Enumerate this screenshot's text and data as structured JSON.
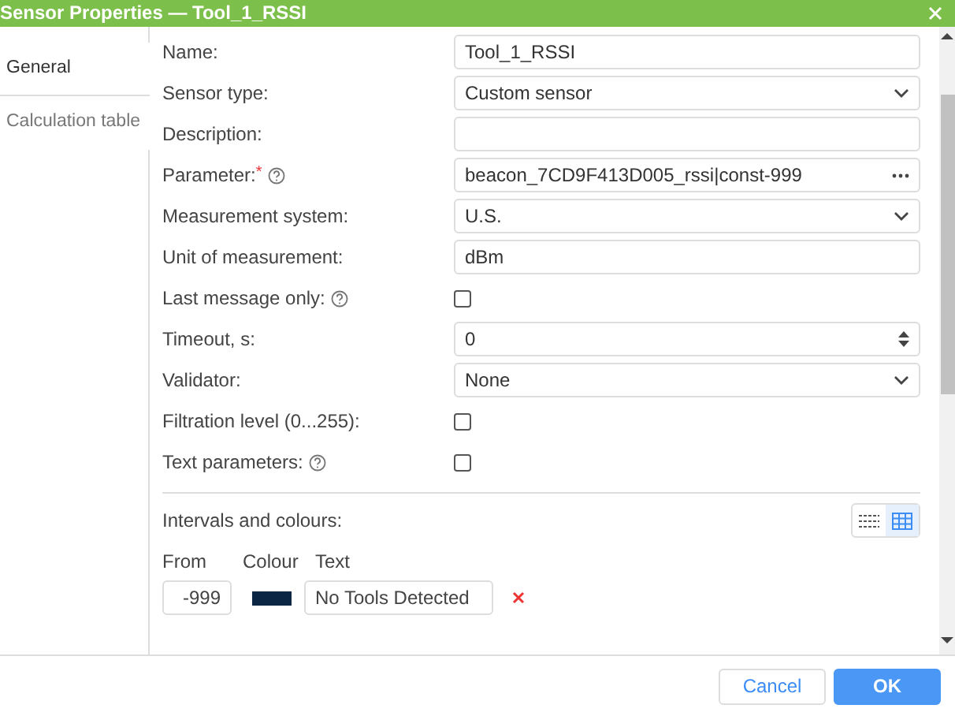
{
  "window": {
    "title": "Sensor Properties — Tool_1_RSSI"
  },
  "tabs": [
    {
      "label": "General",
      "selected": true
    },
    {
      "label": "Calculation table",
      "selected": false
    }
  ],
  "fields": [
    {
      "kind": "text",
      "label": "Name:",
      "value": "Tool_1_RSSI"
    },
    {
      "kind": "select",
      "label": "Sensor type:",
      "value": "Custom sensor"
    },
    {
      "kind": "text",
      "label": "Description:"
    },
    {
      "kind": "picker",
      "label": "Parameter:",
      "required_mark": "*",
      "help": true,
      "value": "beacon_7CD9F413D005_rssi|const-999"
    },
    {
      "kind": "select",
      "label": "Measurement system:",
      "value": "U.S."
    },
    {
      "kind": "text",
      "label": "Unit of measurement:",
      "value": "dBm"
    },
    {
      "kind": "checkbox",
      "label": "Last message only:",
      "help": true,
      "checked": false
    },
    {
      "kind": "number",
      "label": "Timeout, s:",
      "value": "0"
    },
    {
      "kind": "select",
      "label": "Validator:",
      "value": "None"
    },
    {
      "kind": "checkbox",
      "label": "Filtration level (0...255):",
      "checked": false
    },
    {
      "kind": "checkbox",
      "label": "Text parameters:",
      "help": true,
      "checked": false
    }
  ],
  "intervals": {
    "title": "Intervals and colours:",
    "view_toggle": [
      {
        "selected": false
      },
      {
        "selected": true
      }
    ],
    "columns": [
      "From",
      "Colour",
      "Text"
    ],
    "rows": [
      {
        "from": "-999",
        "color": "#0b2545",
        "text": "No Tools Detected"
      }
    ]
  },
  "buttons": [
    {
      "label": "Cancel",
      "kind": "secondary"
    },
    {
      "label": "OK",
      "kind": "primary"
    }
  ]
}
